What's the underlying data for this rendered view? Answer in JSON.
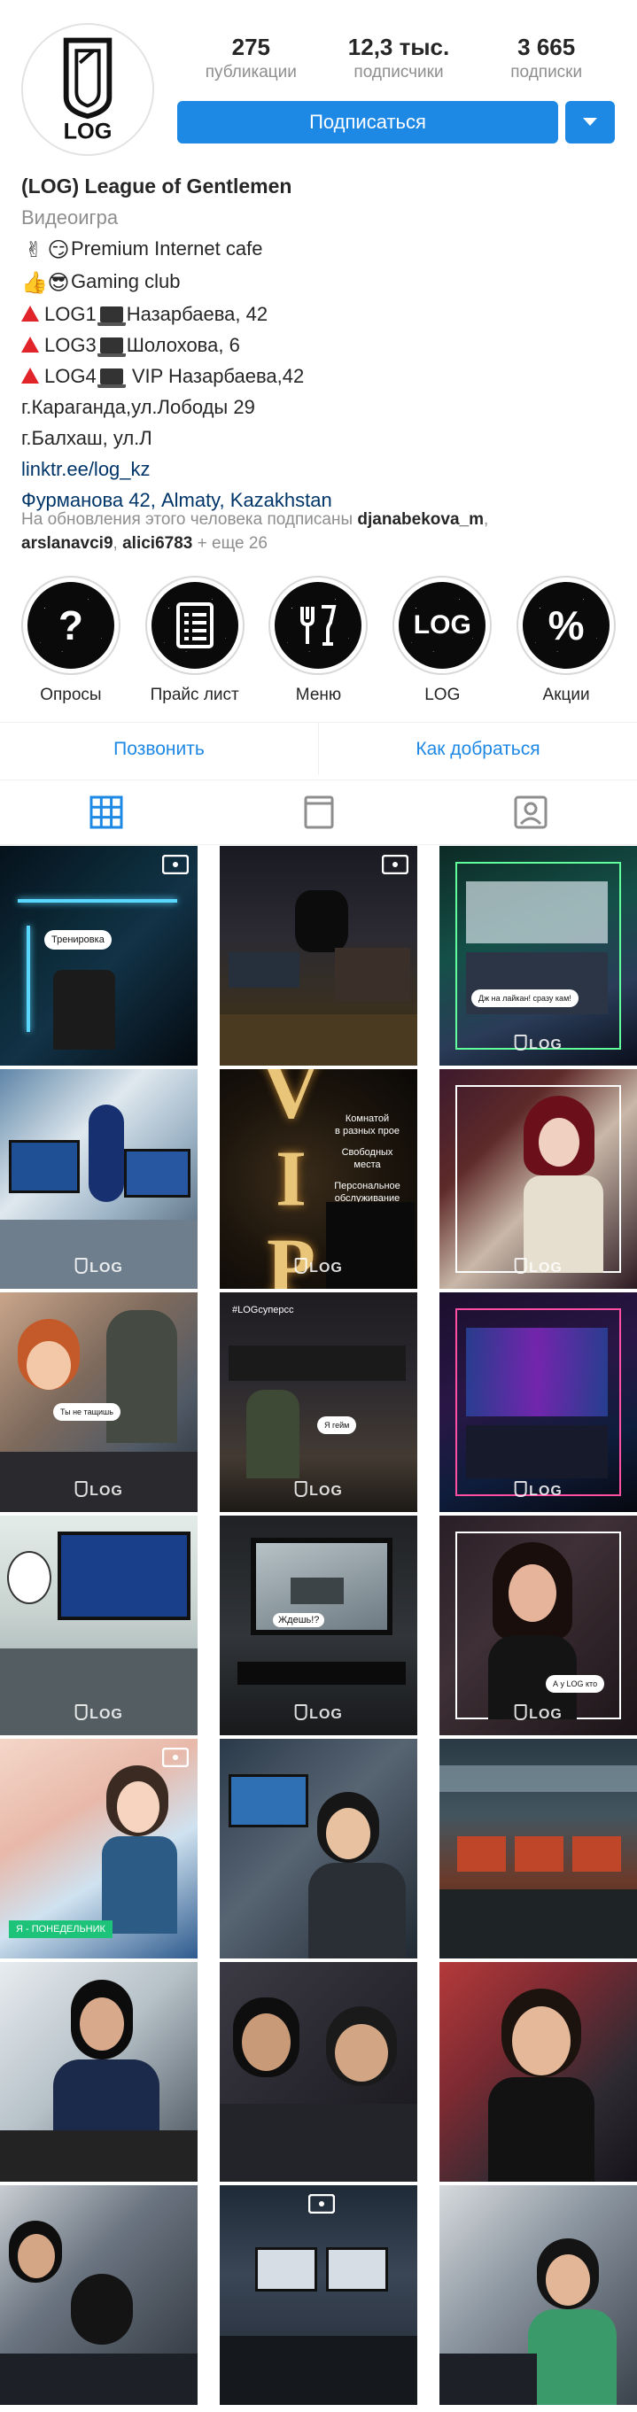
{
  "profile": {
    "stats": [
      {
        "value": "275",
        "label": "публикации"
      },
      {
        "value": "12,3 тыс.",
        "label": "подписчики"
      },
      {
        "value": "3 665",
        "label": "подписки"
      }
    ],
    "follow_label": "Подписаться",
    "name": "(LOG) League of Gentlemen",
    "category": "Видеоигра",
    "bio_lines": [
      "Premium Internet cafe",
      "Gaming club",
      "LOG1",
      "Назарбаева, 42",
      "LOG3",
      "Шолохова, 6",
      "LOG4",
      " VIP Назарбаева,42",
      "г.Караганда,ул.Лободы 29",
      "г.Балхаш, ул.Л"
    ],
    "link": "linktr.ee/log_kz",
    "address": "Фурманова 42, Almaty, Kazakhstan",
    "followed_by": {
      "prefix": "На обновления этого человека подписаны ",
      "user1": "djanabekova_m",
      "sep1": ",",
      "user2": "arslanavci9",
      "sep2": ", ",
      "user3": "alici6783",
      "suffix": " + еще 26"
    },
    "avatar_text": "LOG"
  },
  "highlights": [
    {
      "label": "Опросы",
      "icon": "question-icon",
      "glyph": "?"
    },
    {
      "label": "Прайс лист",
      "icon": "price-list-icon",
      "glyph": ""
    },
    {
      "label": "Меню",
      "icon": "menu-icon",
      "glyph": ""
    },
    {
      "label": "LOG",
      "icon": "log-icon",
      "glyph": "LOG"
    },
    {
      "label": "Акции",
      "icon": "percent-icon",
      "glyph": "%"
    }
  ],
  "actions": {
    "call": "Позвонить",
    "directions": "Как добраться"
  },
  "tabs": [
    "grid-icon",
    "igtv-icon",
    "tagged-icon"
  ],
  "colors": {
    "accent": "#1e88e5",
    "link": "#003569",
    "muted": "#8e8e8e",
    "text": "#262626"
  },
  "posts": {
    "bubble_1": "Тренировка",
    "bubble_2": "Дж на лайкан! сразу кам!",
    "vip": "VIP",
    "vip_line_1": "Комнатой",
    "vip_line_2": "в разных прое",
    "vip_line_3": "Свободных",
    "vip_line_4": "места",
    "vip_line_5": "Персональное",
    "vip_line_6": "обслуживание",
    "bubble_3": "Ты не тащишь",
    "bubble_4": "Я гейм",
    "tag_1": "#LOGсуперсс",
    "caption_1": "Ждешь!?",
    "caption_2": "Я - ПОНЕДЕЛЬНИК",
    "caption_3": "А у LOG кто",
    "logo": "LOG"
  }
}
